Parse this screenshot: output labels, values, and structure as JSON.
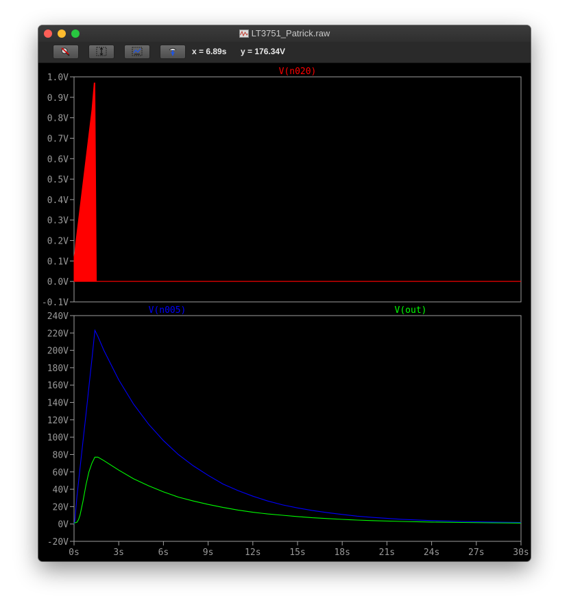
{
  "window": {
    "title": "LT3751_Patrick.raw",
    "icon": "waveform-document-icon"
  },
  "toolbar": {
    "buttons": [
      {
        "name": "zoom-cancel-button",
        "icon": "magnifier-cancel-icon"
      },
      {
        "name": "autorange-y-button",
        "icon": "autorange-y-icon"
      },
      {
        "name": "zoom-extents-button",
        "icon": "zoom-extents-icon"
      },
      {
        "name": "probe-cursor-button",
        "icon": "probe-icon"
      }
    ],
    "x_readout": "x = 6.89s",
    "y_readout": "y = 176.34V"
  },
  "colors": {
    "n020": "#ff0000",
    "n005": "#0000ff",
    "out": "#00ff00",
    "axis_text": "#9a9a9a",
    "frame": "#a0a0a0"
  },
  "chart_data": [
    {
      "type": "area",
      "series": [
        {
          "name": "V(n020)",
          "x": [
            0,
            0.05,
            0.1,
            0.2,
            0.3,
            0.4,
            0.6,
            0.8,
            1.0,
            1.2,
            1.35,
            1.4,
            1.5,
            30
          ],
          "y_upper": [
            0.12,
            0.14,
            0.18,
            0.24,
            0.3,
            0.36,
            0.48,
            0.6,
            0.72,
            0.84,
            0.97,
            0.97,
            0.0,
            0.0
          ]
        }
      ],
      "xlim": [
        0,
        30
      ],
      "ylim": [
        -0.1,
        1.0
      ],
      "y_ticks": [
        "1.0V",
        "0.9V",
        "0.8V",
        "0.7V",
        "0.6V",
        "0.5V",
        "0.4V",
        "0.3V",
        "0.2V",
        "0.1V",
        "0.0V",
        "-0.1V"
      ]
    },
    {
      "type": "line",
      "series": [
        {
          "name": "V(n005)",
          "x": [
            0,
            0.05,
            0.2,
            0.4,
            0.6,
            0.8,
            1.0,
            1.2,
            1.4,
            1.6,
            2,
            3,
            4,
            5,
            6,
            7,
            8,
            9,
            10,
            11,
            12,
            13,
            14,
            15,
            16,
            17,
            18,
            19,
            20,
            22,
            24,
            26,
            28,
            30
          ],
          "y": [
            0,
            3,
            32,
            64,
            95,
            126,
            158,
            190,
            223,
            216,
            200,
            166,
            138,
            115,
            96,
            80,
            67,
            56,
            46,
            38.5,
            32,
            26.5,
            22,
            18.5,
            15.5,
            13,
            11,
            9,
            7.6,
            5.4,
            3.9,
            2.9,
            2.2,
            1.7
          ]
        },
        {
          "name": "V(out)",
          "x": [
            0,
            0.2,
            0.3,
            0.4,
            0.6,
            0.8,
            1.0,
            1.2,
            1.4,
            1.6,
            2,
            3,
            4,
            5,
            6,
            7,
            8,
            9,
            10,
            11,
            12,
            13,
            14,
            15,
            16,
            17,
            18,
            19,
            20,
            22,
            24,
            26,
            28,
            30
          ],
          "y": [
            1,
            2,
            5,
            10,
            26,
            45,
            60,
            70,
            77,
            77,
            73,
            62,
            52,
            44,
            37,
            31,
            26.5,
            22.5,
            19,
            16,
            13.5,
            11.5,
            10,
            8.5,
            7.2,
            6.2,
            5.3,
            4.5,
            3.9,
            2.9,
            2.2,
            1.7,
            1.3,
            1.0
          ]
        }
      ],
      "xlim": [
        0,
        30
      ],
      "ylim": [
        -20,
        240
      ],
      "y_ticks": [
        "240V",
        "220V",
        "200V",
        "180V",
        "160V",
        "140V",
        "120V",
        "100V",
        "80V",
        "60V",
        "40V",
        "20V",
        "0V",
        "-20V"
      ],
      "x_ticks": [
        "0s",
        "3s",
        "6s",
        "9s",
        "12s",
        "15s",
        "18s",
        "21s",
        "24s",
        "27s",
        "30s"
      ]
    }
  ]
}
